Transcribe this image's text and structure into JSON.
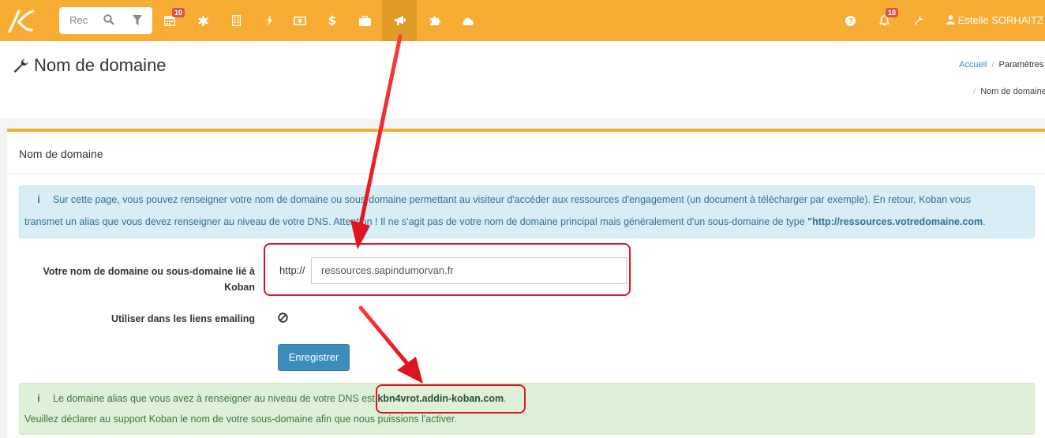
{
  "topbar": {
    "search_placeholder": "Rec",
    "calendar_badge": "10",
    "notifications_badge": "10",
    "user_name": "Estelle SORHAITZ"
  },
  "page": {
    "title": "Nom de domaine",
    "breadcrumb": [
      "Accueil",
      "Paramètres",
      "Nom de domaine"
    ]
  },
  "panel": {
    "title": "Nom de domaine",
    "info_text_1": "Sur cette page, vous pouvez renseigner votre nom de domaine ou sous-domaine permettant au visiteur d'accéder aux ressources d'engagement (un document à télécharger par exemple). En retour, Koban vous",
    "info_text_2": "transmet un alias que vous devez renseigner au niveau de votre DNS. Attention ! Il ne s'agit pas de votre nom de domaine principal mais généralement d'un sous-domaine de type ",
    "info_example": "\"http://ressources.votredomaine.com",
    "info_end": ".",
    "domain_label": "Votre nom de domaine ou sous-domaine lié à Koban",
    "protocol": "http://",
    "domain_value": "ressources.sapindumorvan.fr",
    "emailing_label": "Utiliser dans les liens emailing",
    "save_label": "Enregistrer",
    "success_text_1": "Le domaine alias que vous avez à renseigner au niveau de votre DNS est ",
    "alias": "kbn4vrot.addin-koban.com",
    "success_end": ".",
    "success_text_2": "Veuillez déclarer au support Koban le nom de votre sous-domaine afin que nous puissions l'activer."
  },
  "colors": {
    "topbar": "#f7ac33",
    "primary": "#3c8dbc",
    "annotation": "#e0141e"
  }
}
